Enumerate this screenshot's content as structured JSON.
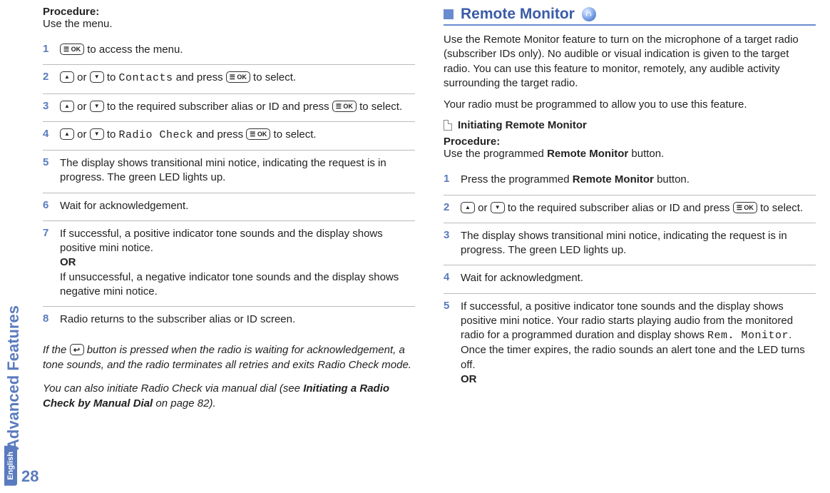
{
  "sidebar": {
    "section_label": "Advanced Features",
    "language": "English",
    "page_number": "28"
  },
  "left": {
    "procedure_label": "Procedure:",
    "procedure_sub": "Use the menu.",
    "keys": {
      "menu_ok": "☰ OK",
      "up": "",
      "down": "",
      "back": ""
    },
    "steps": [
      {
        "n": "1",
        "pre": "",
        "mid": " to access the menu.",
        "type": "menu_only"
      },
      {
        "n": "2",
        "t1": " or ",
        "t2": " to ",
        "mono": "Contacts",
        "t3": " and press ",
        "t4": " to select.",
        "type": "nav_select"
      },
      {
        "n": "3",
        "t1": " or ",
        "t2": " to the required subscriber alias or ID and press ",
        "t4": " to select.",
        "type": "nav_select_plain"
      },
      {
        "n": "4",
        "t1": " or ",
        "t2": " to ",
        "mono": "Radio Check",
        "t3": " and press ",
        "t4": " to select.",
        "type": "nav_select"
      },
      {
        "n": "5",
        "text": "The display shows transitional mini notice, indicating the request is in progress. The green LED lights up.",
        "type": "plain"
      },
      {
        "n": "6",
        "text": "Wait for acknowledgement.",
        "type": "plain"
      },
      {
        "n": "7",
        "text": "If successful, a positive indicator tone sounds and the display shows positive mini notice.",
        "or": "OR",
        "text2": "If unsuccessful, a negative indicator tone sounds and the display shows negative mini notice.",
        "type": "or_block"
      },
      {
        "n": "8",
        "text": "Radio returns to the subscriber alias or ID screen.",
        "type": "plain_last"
      }
    ],
    "note1_a": "If the ",
    "note1_b": " button is pressed when the radio is waiting for acknowledgement, a tone sounds, and the radio terminates all retries and exits Radio Check mode.",
    "note2_a": "You can also initiate Radio Check via manual dial (see ",
    "note2_bold": "Initiating a Radio Check by Manual Dial",
    "note2_b": " on page 82)."
  },
  "right": {
    "section_title": "Remote Monitor",
    "intro1": "Use the Remote Monitor feature to turn on the microphone of a target radio (subscriber IDs only). No audible or visual indication is given to the target radio. You can use this feature to monitor, remotely, any audible activity surrounding the target radio.",
    "intro2": "Your radio must be programmed to allow you to use this feature.",
    "sub_heading": "Initiating Remote Monitor",
    "procedure_label": "Procedure:",
    "procedure_sub_a": "Use the programmed ",
    "procedure_sub_bold": "Remote Monitor",
    "procedure_sub_b": " button.",
    "steps": [
      {
        "n": "1",
        "a": "Press the programmed ",
        "bold": "Remote Monitor",
        "b": " button.",
        "type": "bold_inline"
      },
      {
        "n": "2",
        "t1": " or ",
        "t2": " to the required subscriber alias or ID and press ",
        "t4": " to select.",
        "type": "nav_select_plain"
      },
      {
        "n": "3",
        "text": "The display shows transitional mini notice, indicating the request is in progress. The green LED lights up.",
        "type": "plain"
      },
      {
        "n": "4",
        "text": "Wait for acknowledgment.",
        "type": "plain"
      },
      {
        "n": "5",
        "a": "If successful, a positive indicator tone sounds and the display shows positive mini notice. Your radio starts playing audio from the monitored radio for a programmed duration and display shows ",
        "mono": "Rem. Monitor",
        "b": ".",
        "c": "Once the timer expires, the radio sounds an alert tone and the LED turns off.",
        "or": "OR",
        "type": "final_block"
      }
    ]
  }
}
